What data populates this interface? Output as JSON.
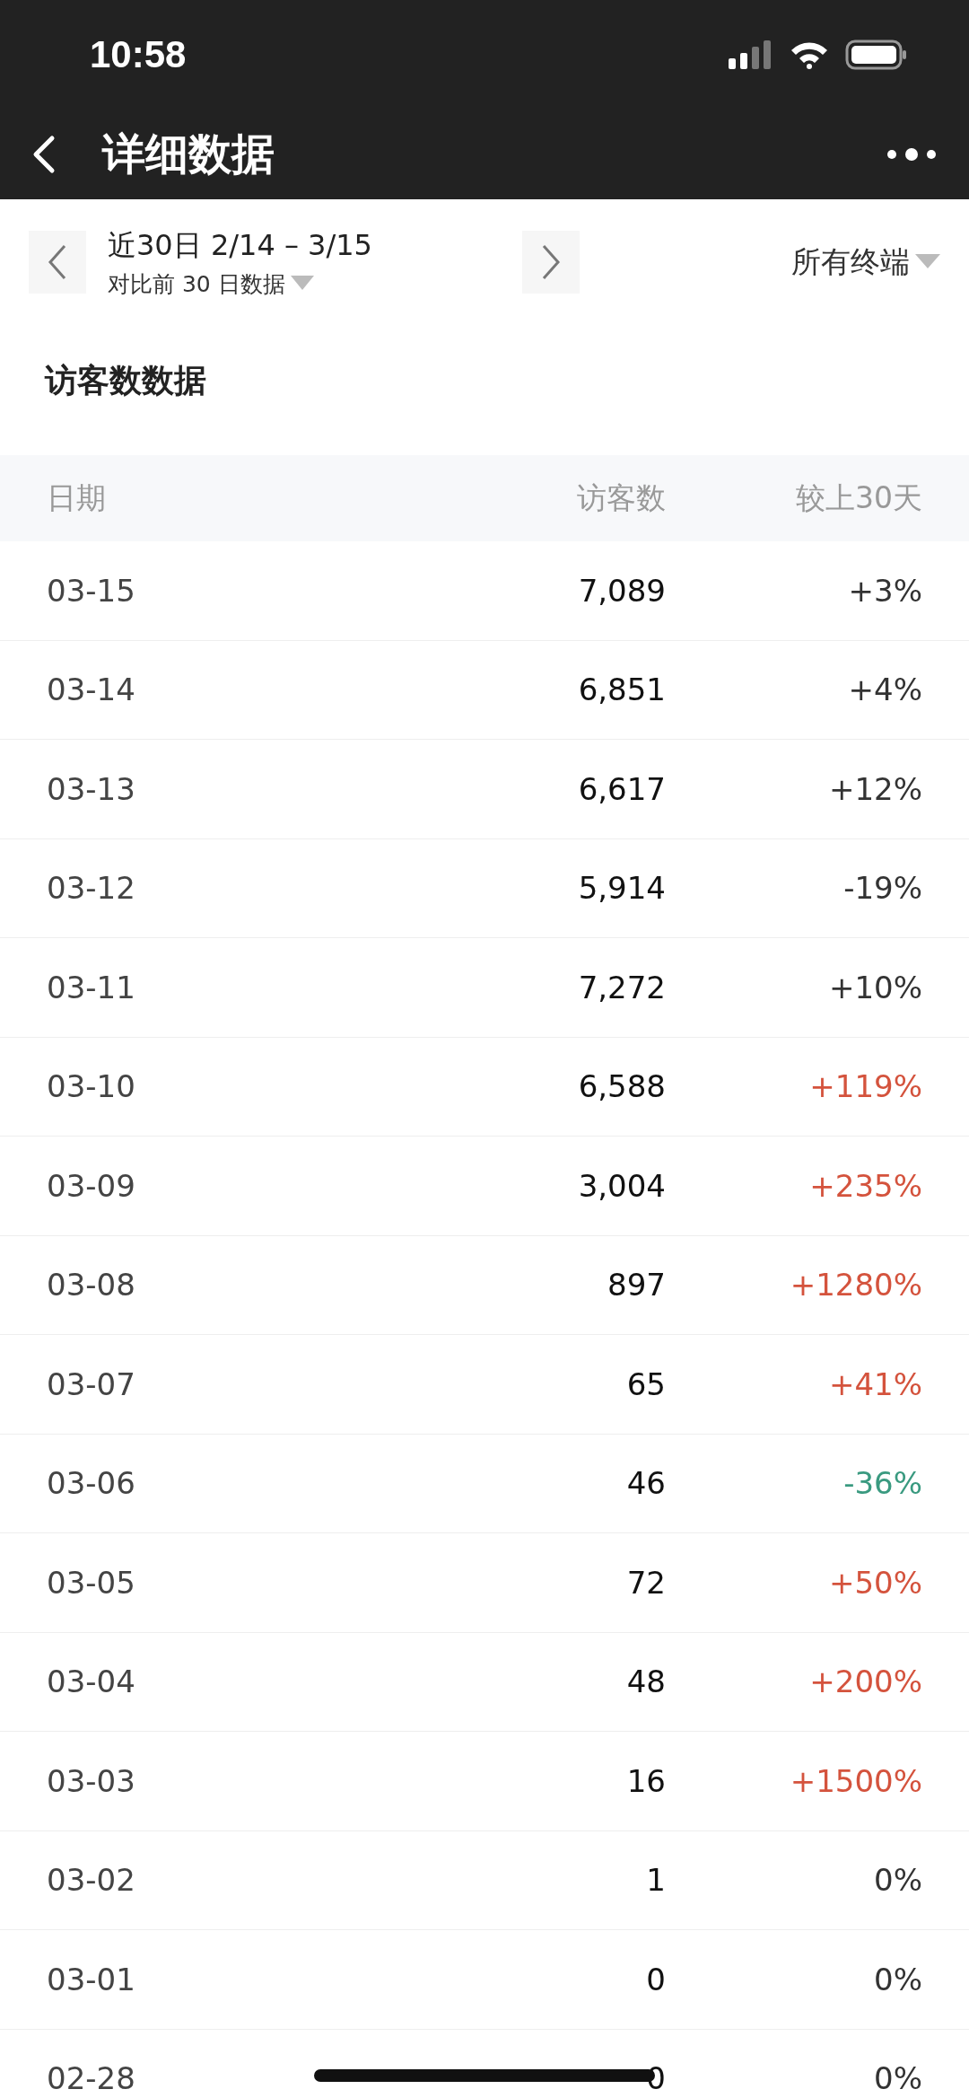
{
  "status_bar": {
    "time": "10:58"
  },
  "nav": {
    "title": "详细数据"
  },
  "date_bar": {
    "range": "近30日 2/14 – 3/15",
    "compare": "对比前 30 日数据",
    "terminal": "所有终端"
  },
  "section": {
    "title": "访客数数据"
  },
  "table": {
    "columns": [
      "日期",
      "访客数",
      "较上30天"
    ],
    "rows": [
      {
        "date": "03-15",
        "visitors": "7,089",
        "change": "+3%",
        "color": "#333333"
      },
      {
        "date": "03-14",
        "visitors": "6,851",
        "change": "+4%",
        "color": "#333333"
      },
      {
        "date": "03-13",
        "visitors": "6,617",
        "change": "+12%",
        "color": "#333333"
      },
      {
        "date": "03-12",
        "visitors": "5,914",
        "change": "-19%",
        "color": "#333333"
      },
      {
        "date": "03-11",
        "visitors": "7,272",
        "change": "+10%",
        "color": "#333333"
      },
      {
        "date": "03-10",
        "visitors": "6,588",
        "change": "+119%",
        "color": "#d4533d"
      },
      {
        "date": "03-09",
        "visitors": "3,004",
        "change": "+235%",
        "color": "#d4533d"
      },
      {
        "date": "03-08",
        "visitors": "897",
        "change": "+1280%",
        "color": "#d4533d"
      },
      {
        "date": "03-07",
        "visitors": "65",
        "change": "+41%",
        "color": "#d4533d"
      },
      {
        "date": "03-06",
        "visitors": "46",
        "change": "-36%",
        "color": "#3a9a80"
      },
      {
        "date": "03-05",
        "visitors": "72",
        "change": "+50%",
        "color": "#d4533d"
      },
      {
        "date": "03-04",
        "visitors": "48",
        "change": "+200%",
        "color": "#d4533d"
      },
      {
        "date": "03-03",
        "visitors": "16",
        "change": "+1500%",
        "color": "#d4533d"
      },
      {
        "date": "03-02",
        "visitors": "1",
        "change": "0%",
        "color": "#333333"
      },
      {
        "date": "03-01",
        "visitors": "0",
        "change": "0%",
        "color": "#333333"
      },
      {
        "date": "02-28",
        "visitors": "0",
        "change": "0%",
        "color": "#333333"
      }
    ]
  }
}
